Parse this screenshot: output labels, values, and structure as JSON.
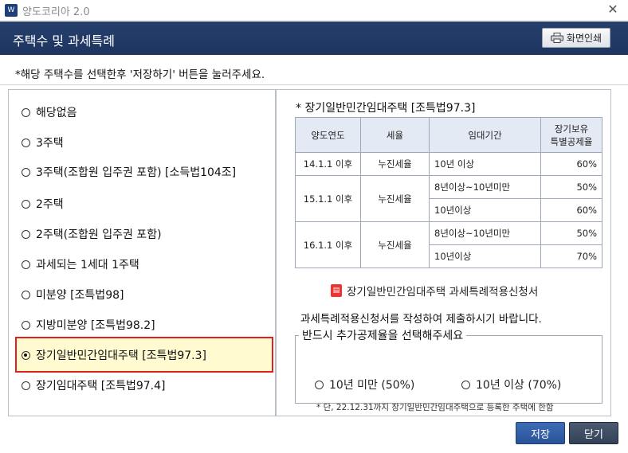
{
  "window": {
    "title": "양도코리아 2.0",
    "app_icon": "W",
    "close_glyph": "✕"
  },
  "header": {
    "title": "주택수 및 과세특례",
    "print_label": "화면인쇄"
  },
  "instruction": "*해당 주택수를 선택한후 '저장하기' 버튼을 눌러주세요.",
  "options": [
    {
      "label": "해당없음",
      "selected": false
    },
    {
      "label": "3주택",
      "selected": false
    },
    {
      "label": "3주택(조합원 입주권 포함) [소득법104조]",
      "selected": false
    },
    {
      "label": "2주택",
      "selected": false
    },
    {
      "label": "2주택(조합원 입주권 포함)",
      "selected": false
    },
    {
      "label": "과세되는 1세대 1주택",
      "selected": false
    },
    {
      "label": "미분양 [조특법98]",
      "selected": false
    },
    {
      "label": "지방미분양 [조특법98.2]",
      "selected": false
    },
    {
      "label": "장기일반민간임대주택 [조특법97.3]",
      "selected": true
    },
    {
      "label": "장기임대주택 [조특법97.4]",
      "selected": false
    }
  ],
  "detail": {
    "title": "* 장기일반민간임대주택 [조특법97.3]",
    "table": {
      "headers": [
        "양도연도",
        "세율",
        "임대기간",
        "장기보유 특별공제율"
      ],
      "header_rate_line1": "장기보유",
      "header_rate_line2": "특별공제율",
      "rows": [
        {
          "year": "14.1.1 이후",
          "tax": "누진세율",
          "period": "10년 이상",
          "rate": "60%"
        },
        {
          "year": "15.1.1 이후",
          "tax": "누진세율",
          "period": "8년이상~10년미만",
          "rate": "50%"
        },
        {
          "year": "",
          "tax": "",
          "period": "10년이상",
          "rate": "60%"
        },
        {
          "year": "16.1.1 이후",
          "tax": "누진세율",
          "period": "8년이상~10년미만",
          "rate": "50%"
        },
        {
          "year": "",
          "tax": "",
          "period": "10년이상",
          "rate": "70%"
        }
      ]
    },
    "apply_link": "장기일반민간임대주택  과세특례적용신청서",
    "apply_instruction": "과세특례적용신청서를 작성하여 제출하시기 바랍니다.",
    "rate_group": {
      "legend": "반드시 추가공제율을 선택해주세요",
      "options": [
        {
          "label": "10년 미만 (50%)",
          "selected": false
        },
        {
          "label": "10년 이상 (70%)",
          "selected": false
        }
      ],
      "note": "* 단, 22.12.31까지 장기일반민간임대주택으로 등록한 주택에 한함"
    }
  },
  "buttons": {
    "save": "저장",
    "close": "닫기"
  },
  "colors": {
    "header_bg": "#263f6c",
    "selected_border": "#e02020",
    "selected_bg": "#fffad0",
    "save_bg": "#2a5398",
    "close_bg": "#344257"
  }
}
